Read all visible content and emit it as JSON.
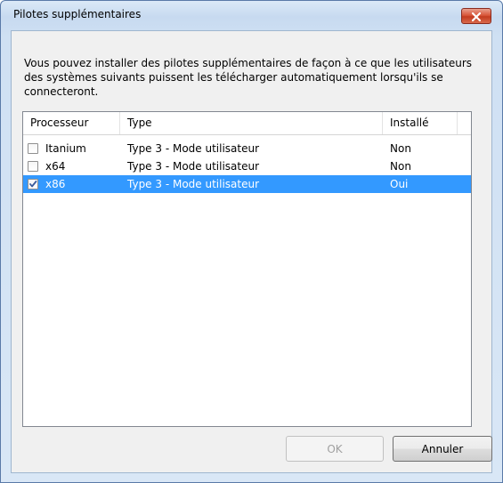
{
  "window": {
    "title": "Pilotes supplémentaires"
  },
  "description": "Vous pouvez installer des pilotes supplémentaires de façon à ce que les utilisateurs des systèmes suivants puissent les télécharger automatiquement lorsqu'ils se connecteront.",
  "table": {
    "columns": [
      "Processeur",
      "Type",
      "Installé"
    ],
    "rows": [
      {
        "processor": "Itanium",
        "type": "Type 3 - Mode utilisateur",
        "installed": "Non",
        "checked": false,
        "selected": false
      },
      {
        "processor": "x64",
        "type": "Type 3 - Mode utilisateur",
        "installed": "Non",
        "checked": false,
        "selected": false
      },
      {
        "processor": "x86",
        "type": "Type 3 - Mode utilisateur",
        "installed": "Oui",
        "checked": true,
        "selected": true
      }
    ]
  },
  "buttons": {
    "ok": "OK",
    "cancel": "Annuler"
  },
  "colors": {
    "selection": "#3399ff",
    "close": "#c33b1f"
  },
  "icons": {
    "close": "close-icon",
    "check": "checkmark-icon"
  }
}
